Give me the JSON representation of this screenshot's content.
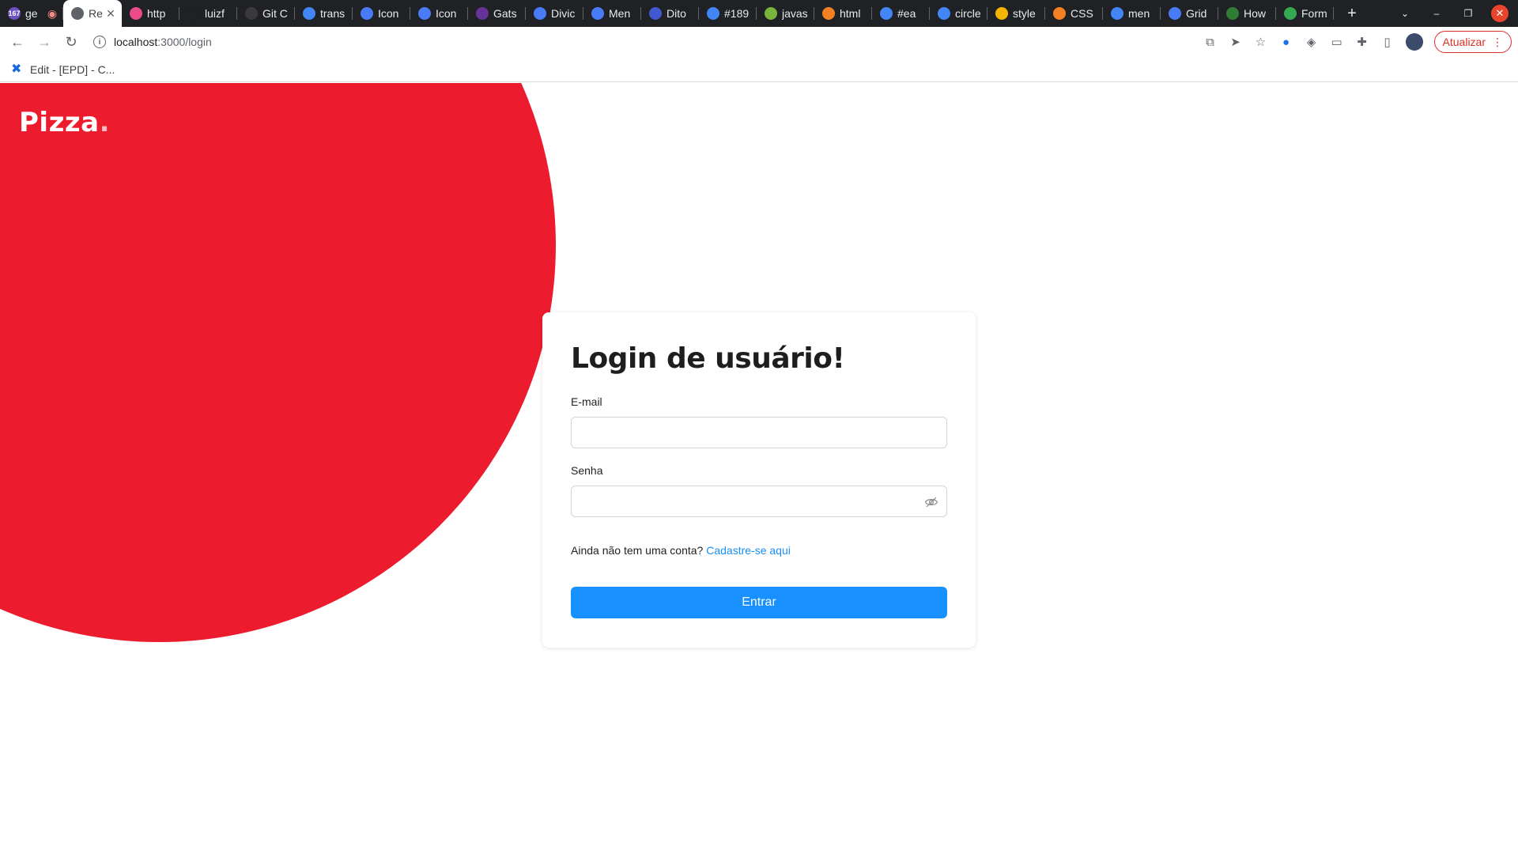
{
  "browser": {
    "tabs": [
      {
        "title": "ge",
        "favicon": "github-badge-icon",
        "color": "#6e4fbf",
        "badge": "167"
      },
      {
        "title": "Re",
        "favicon": "loading-icon",
        "color": "#5f6368",
        "active": true
      },
      {
        "title": "http",
        "favicon": "dribbble-icon",
        "color": "#ea4c89"
      },
      {
        "title": "luizf",
        "favicon": "github-icon",
        "color": "#202124"
      },
      {
        "title": "Git C",
        "favicon": "gitcdn-icon",
        "color": "#3a3a3a"
      },
      {
        "title": "trans",
        "favicon": "google-icon",
        "color": "#4285f4"
      },
      {
        "title": "Icon",
        "favicon": "diamond-icon",
        "color": "#4a7bf7"
      },
      {
        "title": "Icon",
        "favicon": "diamond-icon",
        "color": "#4a7bf7"
      },
      {
        "title": "Gats",
        "favicon": "gatsby-icon",
        "color": "#663399"
      },
      {
        "title": "Divic",
        "favicon": "diamond-icon",
        "color": "#4a7bf7"
      },
      {
        "title": "Men",
        "favicon": "diamond-icon",
        "color": "#4a7bf7"
      },
      {
        "title": "Dito",
        "favicon": "dito-icon",
        "color": "#4158d0"
      },
      {
        "title": "#189",
        "favicon": "google-icon",
        "color": "#4285f4"
      },
      {
        "title": "javas",
        "favicon": "sparkle-icon",
        "color": "#79b53c"
      },
      {
        "title": "html",
        "favicon": "stackoverflow-icon",
        "color": "#f48024"
      },
      {
        "title": "#ea",
        "favicon": "google-icon",
        "color": "#4285f4"
      },
      {
        "title": "circle",
        "favicon": "google-icon",
        "color": "#4285f4"
      },
      {
        "title": "style",
        "favicon": "lightning-icon",
        "color": "#f4b400"
      },
      {
        "title": "CSS",
        "favicon": "stackoverflow-icon",
        "color": "#f48024"
      },
      {
        "title": "men",
        "favicon": "google-icon",
        "color": "#4285f4"
      },
      {
        "title": "Grid",
        "favicon": "diamond-icon",
        "color": "#4a7bf7"
      },
      {
        "title": "How",
        "favicon": "infinity-icon",
        "color": "#2e7d32"
      },
      {
        "title": "Form",
        "favicon": "sheet-icon",
        "color": "#34a853"
      }
    ],
    "url_host": "localhost",
    "url_path": ":3000/login",
    "update_label": "Atualizar",
    "bookmark": "Edit - [EPD] - C..."
  },
  "page": {
    "logo": "Pizza",
    "logo_dot": ".",
    "circle_color": "#ec1c2e",
    "title": "Login de usuário!",
    "email_label": "E-mail",
    "email_value": "",
    "password_label": "Senha",
    "password_value": "",
    "signup_prompt": "Ainda não tem uma conta? ",
    "signup_link": "Cadastre-se aqui",
    "submit_label": "Entrar",
    "accent_color": "#1890ff"
  }
}
